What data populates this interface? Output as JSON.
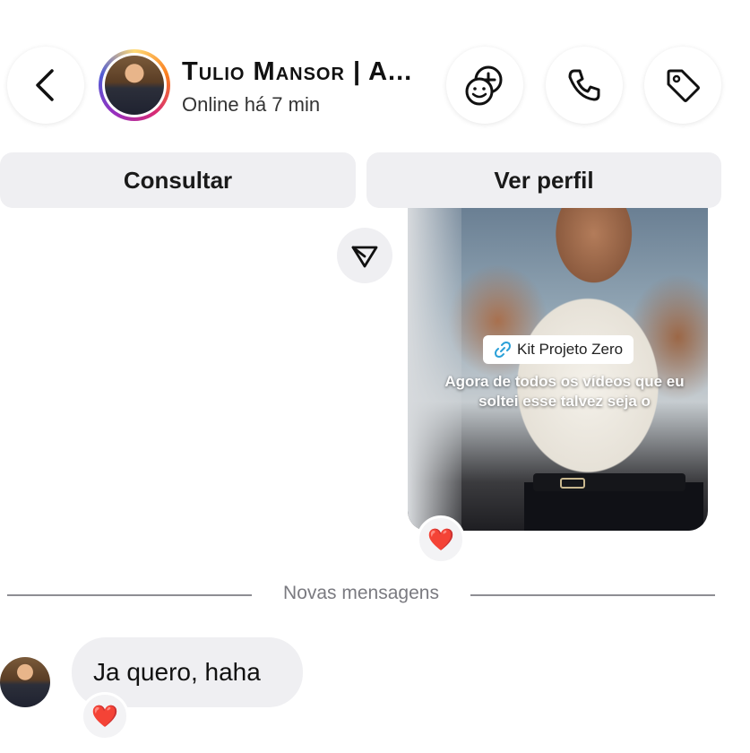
{
  "header": {
    "contact_name": "Tulio Mansor | A...",
    "status": "Online há 7 min",
    "icons": [
      "back-arrow-icon",
      "add-to-group-icon",
      "phone-icon",
      "tag-icon"
    ]
  },
  "actions": {
    "consult_label": "Consultar",
    "profile_label": "Ver perfil"
  },
  "reel": {
    "link_chip": "Kit Projeto Zero",
    "caption": "Agora de todos os vídeos que eu soltei esse talvez seja o",
    "reaction": "❤️"
  },
  "divider": {
    "label": "Novas mensagens"
  },
  "message": {
    "text": "Ja quero, haha",
    "reaction": "❤️"
  },
  "colors": {
    "pill_background": "#efeff2",
    "divider_text": "#7a7a80",
    "link_icon": "#2aa0d8"
  }
}
